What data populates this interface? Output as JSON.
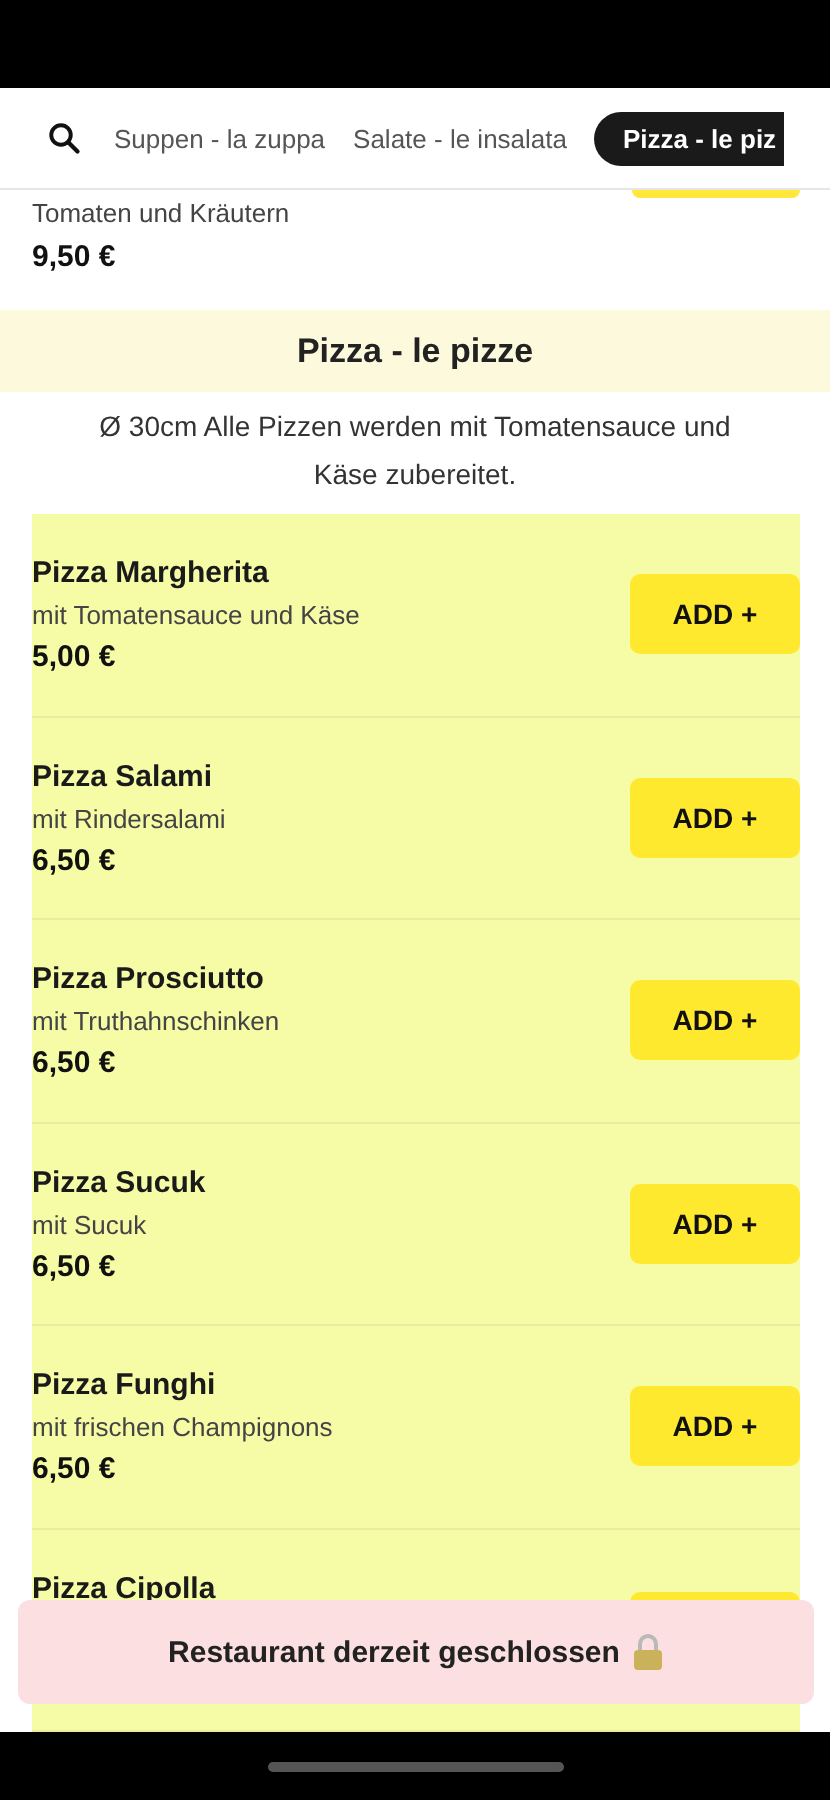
{
  "tabs": [
    {
      "label": "Suppen - la zuppa",
      "selected": false
    },
    {
      "label": "Salate - le insalata",
      "selected": false
    },
    {
      "label": "Pizza - le piz",
      "selected": true
    }
  ],
  "previous_item": {
    "description": "Tomaten und Kräutern",
    "price": "9,50 €"
  },
  "section": {
    "title": "Pizza - le pizze",
    "note": "Ø 30cm Alle Pizzen werden mit Tomatensauce und Käse zubereitet."
  },
  "items": [
    {
      "name": "Pizza Margherita",
      "description": "mit Tomatensauce und Käse",
      "price": "5,00 €",
      "button": "ADD +"
    },
    {
      "name": "Pizza Salami",
      "description": "mit Rindersalami",
      "price": "6,50 €",
      "button": "ADD +"
    },
    {
      "name": "Pizza Prosciutto",
      "description": "mit Truthahnschinken",
      "price": "6,50 €",
      "button": "ADD +"
    },
    {
      "name": "Pizza Sucuk",
      "description": "mit Sucuk",
      "price": "6,50 €",
      "button": "ADD +"
    },
    {
      "name": "Pizza Funghi",
      "description": "mit frischen Champignons",
      "price": "6,50 €",
      "button": "ADD +"
    },
    {
      "name": "Pizza Cipolla"
    }
  ],
  "banner": {
    "text": "Restaurant derzeit geschlossen"
  }
}
